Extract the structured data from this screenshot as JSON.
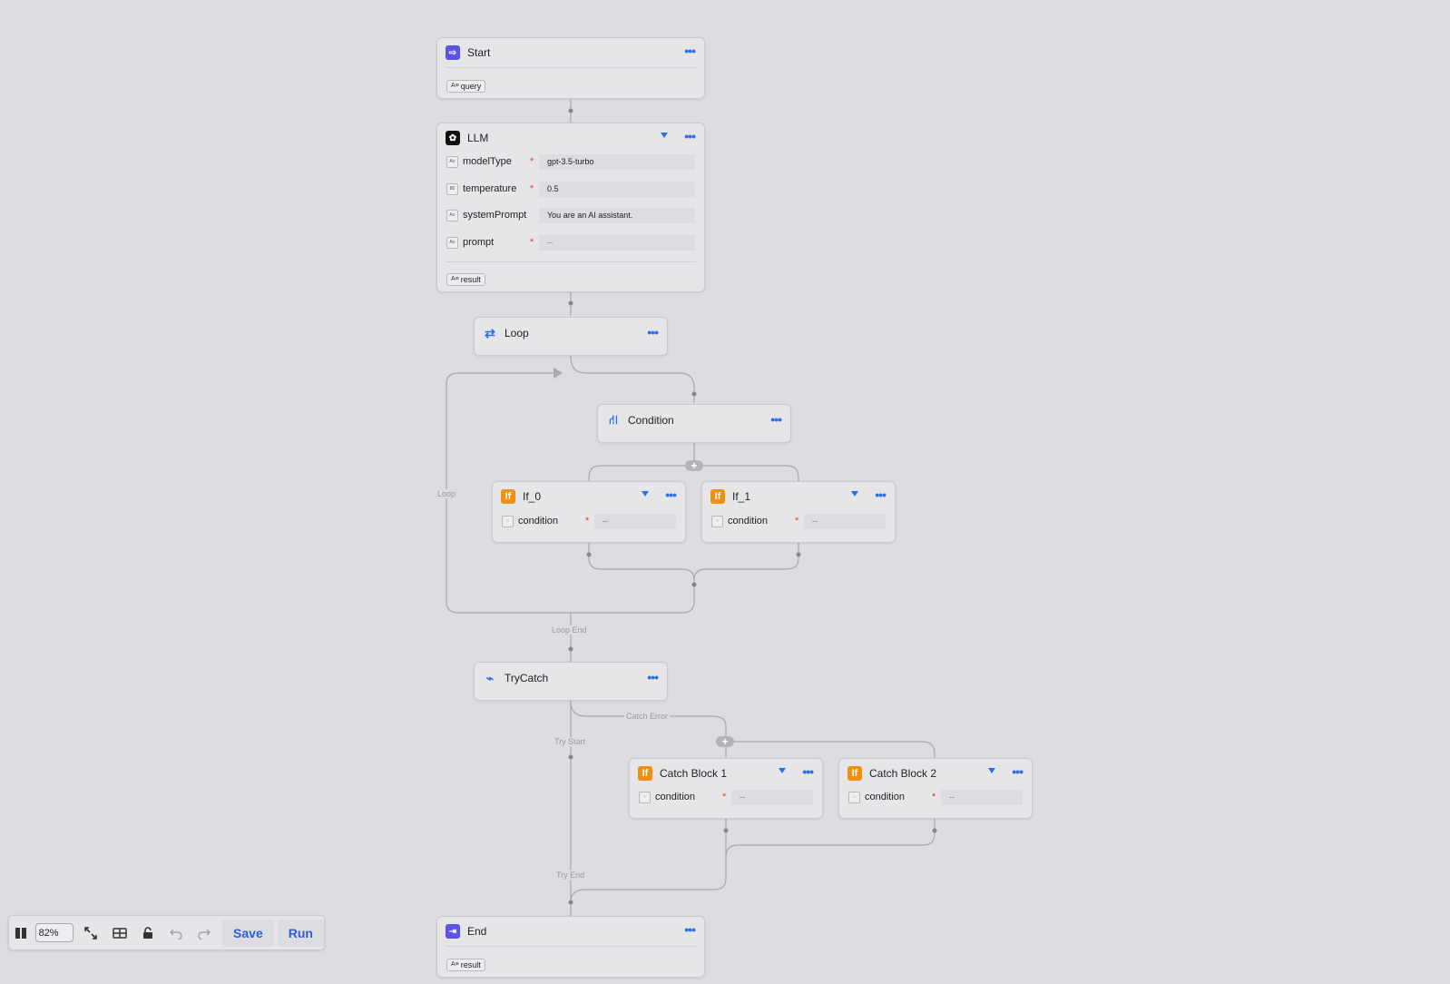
{
  "nodes": {
    "start": {
      "title": "Start",
      "output": "query"
    },
    "llm": {
      "title": "LLM",
      "inputs": [
        {
          "label": "modelType",
          "required": true,
          "value": "gpt-3.5-turbo"
        },
        {
          "label": "temperature",
          "required": true,
          "value": "0.5"
        },
        {
          "label": "systemPrompt",
          "required": false,
          "value": "You are an AI assistant."
        },
        {
          "label": "prompt",
          "required": true,
          "value": "--"
        }
      ],
      "output": "result"
    },
    "loop": {
      "title": "Loop"
    },
    "condition": {
      "title": "Condition"
    },
    "if0": {
      "title": "If_0",
      "field": "condition",
      "value": "--"
    },
    "if1": {
      "title": "If_1",
      "field": "condition",
      "value": "--"
    },
    "trycatch": {
      "title": "TryCatch"
    },
    "catch1": {
      "title": "Catch Block 1",
      "field": "condition",
      "value": "--"
    },
    "catch2": {
      "title": "Catch Block 2",
      "field": "condition",
      "value": "--"
    },
    "end": {
      "title": "End",
      "output": "result"
    }
  },
  "edge_labels": {
    "loop": "Loop",
    "loop_end": "Loop End",
    "catch_error": "Catch Error",
    "try_start": "Try Start",
    "try_end": "Try End"
  },
  "toolbar": {
    "zoom": "82%",
    "save_label": "Save",
    "run_label": "Run"
  },
  "icons": {
    "start": "start-icon",
    "llm": "llm-icon",
    "loop": "loop-icon",
    "condition": "condition-icon",
    "if": "if-icon",
    "trycatch": "trycatch-icon",
    "end": "end-icon",
    "more": "more-dots-icon"
  },
  "colors": {
    "canvas": "#dcdde0",
    "node": "#e6e6e9",
    "accent": "#2f6fe4",
    "if_icon": "#f0900c",
    "start_icon": "#5b52e6",
    "required": "#e53935",
    "edge": "#a8a9ae"
  }
}
